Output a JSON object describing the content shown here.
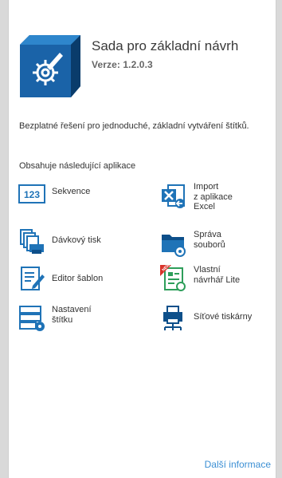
{
  "header": {
    "title": "Sada pro základní návrh",
    "version": "Verze: 1.2.0.3"
  },
  "description": "Bezplatné řešení pro jednoduché, základní vytváření štítků.",
  "contains_label": "Obsahuje následující aplikace",
  "apps": [
    {
      "label": "Sekvence",
      "icon": "sequence-123-icon"
    },
    {
      "label": "Import\nz aplikace\nExcel",
      "icon": "excel-import-icon"
    },
    {
      "label": "Dávkový tisk",
      "icon": "batch-print-icon"
    },
    {
      "label": "Správa\nsouborů",
      "icon": "file-management-icon"
    },
    {
      "label": "Editor šablon",
      "icon": "template-editor-icon"
    },
    {
      "label": "Vlastní\nnávrhář Lite",
      "icon": "custom-designer-icon"
    },
    {
      "label": "Nastavení\nštítku",
      "icon": "label-settings-icon"
    },
    {
      "label": "Síťové tiskárny",
      "icon": "network-printers-icon"
    }
  ],
  "icon_text": {
    "sequence": "123",
    "new_badge": "NEW"
  },
  "more_link": "Další informace",
  "colors": {
    "accent": "#1f73b7",
    "link": "#3b8fd4",
    "green": "#2e9e5a"
  }
}
